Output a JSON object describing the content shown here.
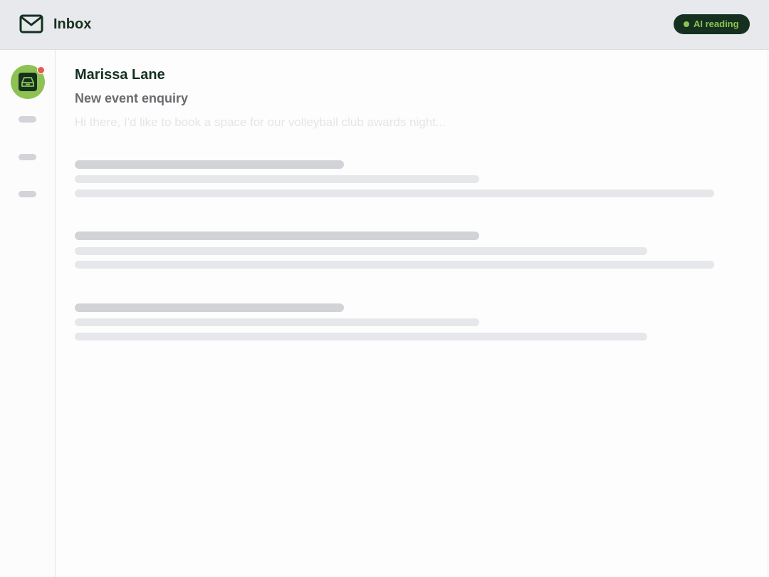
{
  "header": {
    "title": "Inbox",
    "icon": "mail-icon",
    "status": {
      "label": "AI reading",
      "background": "#15301f",
      "text_color": "#8dc253",
      "dot_color": "#8dc253"
    }
  },
  "sidebar": {
    "active_item": {
      "icon": "inbox-tray-icon",
      "accent": "#8dc253",
      "has_notification": true,
      "notification_color": "#e45a4f"
    },
    "placeholder_items": 3
  },
  "message": {
    "sender": "Marissa Lane",
    "subject": "New event enquiry",
    "preview": "Hi there, I'd like to book a space for our volleyball club awards night..."
  },
  "colors": {
    "brand_dark": "#15301f",
    "brand_green": "#8dc253",
    "header_bg": "#e8e9ec"
  }
}
